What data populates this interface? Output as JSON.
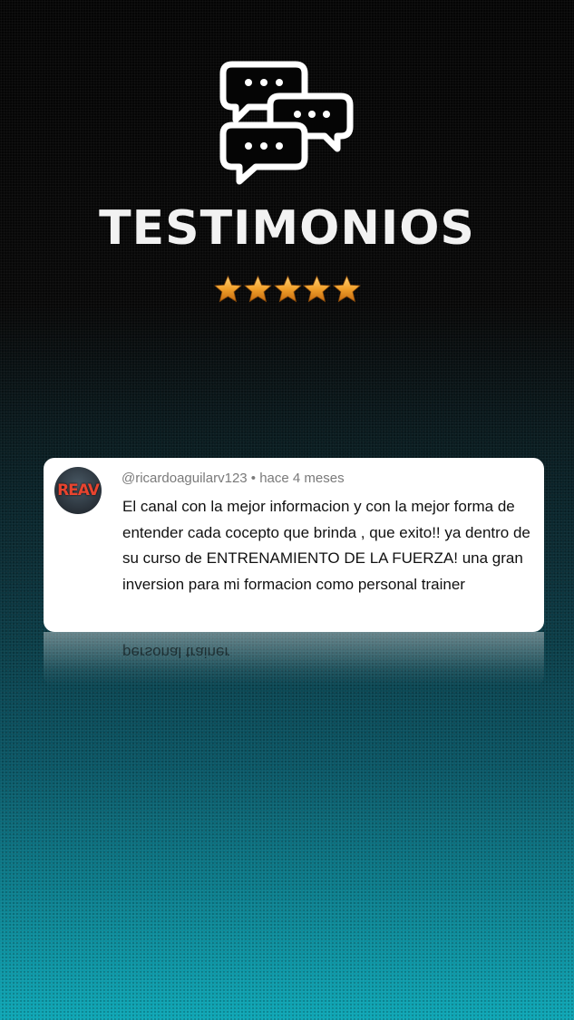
{
  "header": {
    "icon": "chat-bubbles-icon",
    "title": "TESTIMONIOS",
    "rating": 5,
    "rating_max": 5
  },
  "testimonial": {
    "avatar_text": "REAV",
    "meta": "@ricardoaguilarv123 • hace 4 meses",
    "text": "El canal con la mejor informacion y con la mejor forma de entender cada cocepto que brinda , que exito!! ya dentro de su curso de ENTRENAMIENTO DE LA FUERZA! una gran inversion para mi formacion como personal trainer",
    "reflection_text": "personal trainer"
  },
  "colors": {
    "background_top": "#050505",
    "background_bottom": "#0ea7b6",
    "card": "#ffffff",
    "star": "#f2a12b"
  }
}
